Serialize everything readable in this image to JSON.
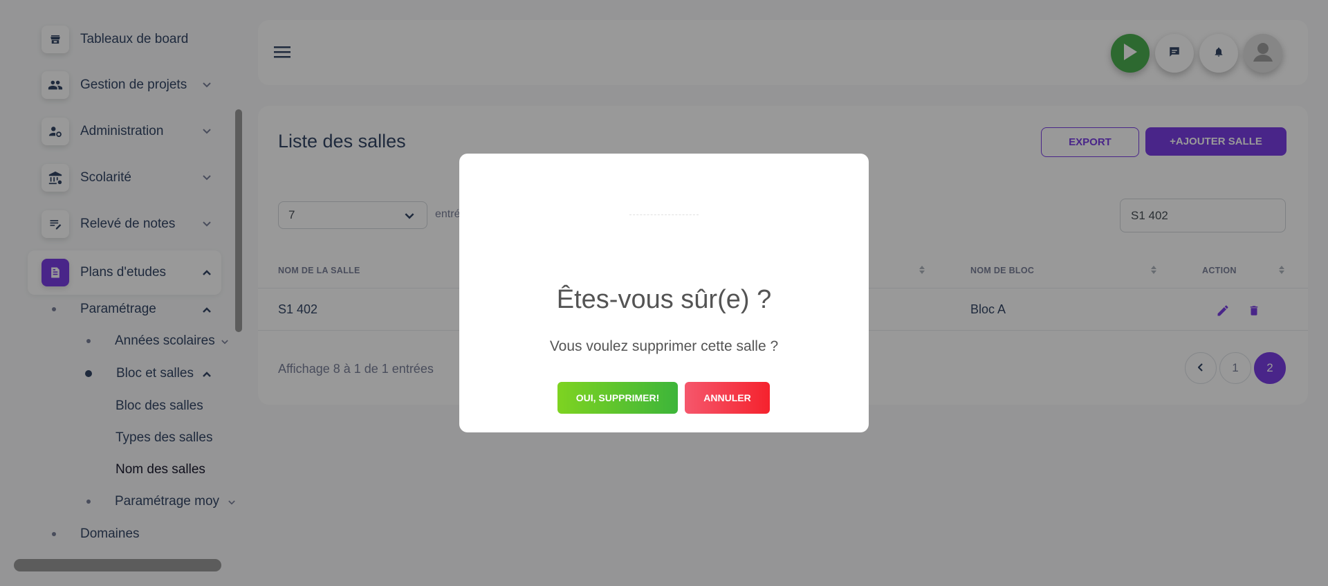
{
  "sidebar": {
    "items": [
      {
        "label": "Tableaux de board",
        "icon": "store-icon"
      },
      {
        "label": "Gestion de projets",
        "icon": "people-icon"
      },
      {
        "label": "Administration",
        "icon": "admin-settings-icon"
      },
      {
        "label": "Scolarité",
        "icon": "bank-icon"
      },
      {
        "label": "Relevé de notes",
        "icon": "edit-notes-icon"
      },
      {
        "label": "Plans d'etudes",
        "icon": "document-icon"
      }
    ],
    "sub": {
      "parametrage": "Paramétrage",
      "annees": "Années scolaires",
      "bloc_salles": "Bloc et salles",
      "bloc_des_salles": "Bloc des salles",
      "types_salles": "Types des salles",
      "nom_salles": "Nom des salles",
      "parametrage_moy": "Paramétrage moy",
      "domaines": "Domaines"
    }
  },
  "card": {
    "title": "Liste des salles",
    "export_label": "EXPORT",
    "add_label": "+AJOUTER SALLE",
    "select_value": "7",
    "entries_label": "entré",
    "search_value": "S1 402",
    "columns": [
      "NOM DE LA SALLE",
      "NOM DE BLOC",
      "ACTION"
    ],
    "rows": [
      {
        "nom_salle": "S1 402",
        "nom_bloc": "Bloc A"
      }
    ],
    "info": "Affichage 8 à 1 de 1 entrées",
    "pages": [
      "1",
      "2"
    ],
    "active_page": "2"
  },
  "modal": {
    "title": "Êtes-vous sûr(e) ?",
    "text": "Vous voulez supprimer cette salle ?",
    "confirm_label": "OUI, SUPPRIMER!",
    "cancel_label": "ANNULER"
  },
  "colors": {
    "accent": "#7b3fe4",
    "confirm": "#4caf50",
    "cancel": "#f5222d"
  }
}
